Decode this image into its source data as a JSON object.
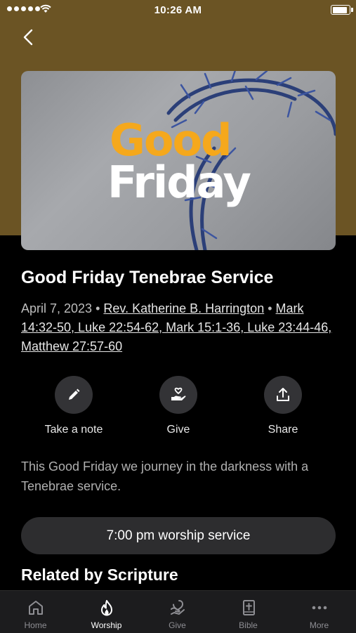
{
  "status_bar": {
    "time": "10:26 AM"
  },
  "hero": {
    "line1": "Good",
    "line2": "Friday"
  },
  "event": {
    "title": "Good Friday Tenebrae Service",
    "date": "April 7, 2023",
    "separator": "•",
    "speaker": "Rev. Katherine B. Harrington",
    "scripture": "Mark 14:32-50, Luke 22:54-62, Mark 15:1-36, Luke 23:44-46, Matthew 27:57-60",
    "description": "This Good Friday we journey in the darkness with a Tenebrae service."
  },
  "actions": [
    {
      "label": "Take a note",
      "icon": "pencil-icon"
    },
    {
      "label": "Give",
      "icon": "heart-hand-icon"
    },
    {
      "label": "Share",
      "icon": "share-icon"
    }
  ],
  "cta": {
    "label": "7:00 pm worship service"
  },
  "related": {
    "heading": "Related by Scripture"
  },
  "tabbar": {
    "tabs": [
      {
        "label": "Home",
        "icon": "home-icon"
      },
      {
        "label": "Worship",
        "icon": "flame-icon",
        "active": true
      },
      {
        "label": "Give",
        "icon": "give-icon"
      },
      {
        "label": "Bible",
        "icon": "bible-icon"
      },
      {
        "label": "More",
        "icon": "more-icon"
      }
    ]
  },
  "colors": {
    "header_band": "#6b5424",
    "accent_orange": "#f5a81c",
    "background": "#000000",
    "tabbar": "#1c1c1e"
  }
}
